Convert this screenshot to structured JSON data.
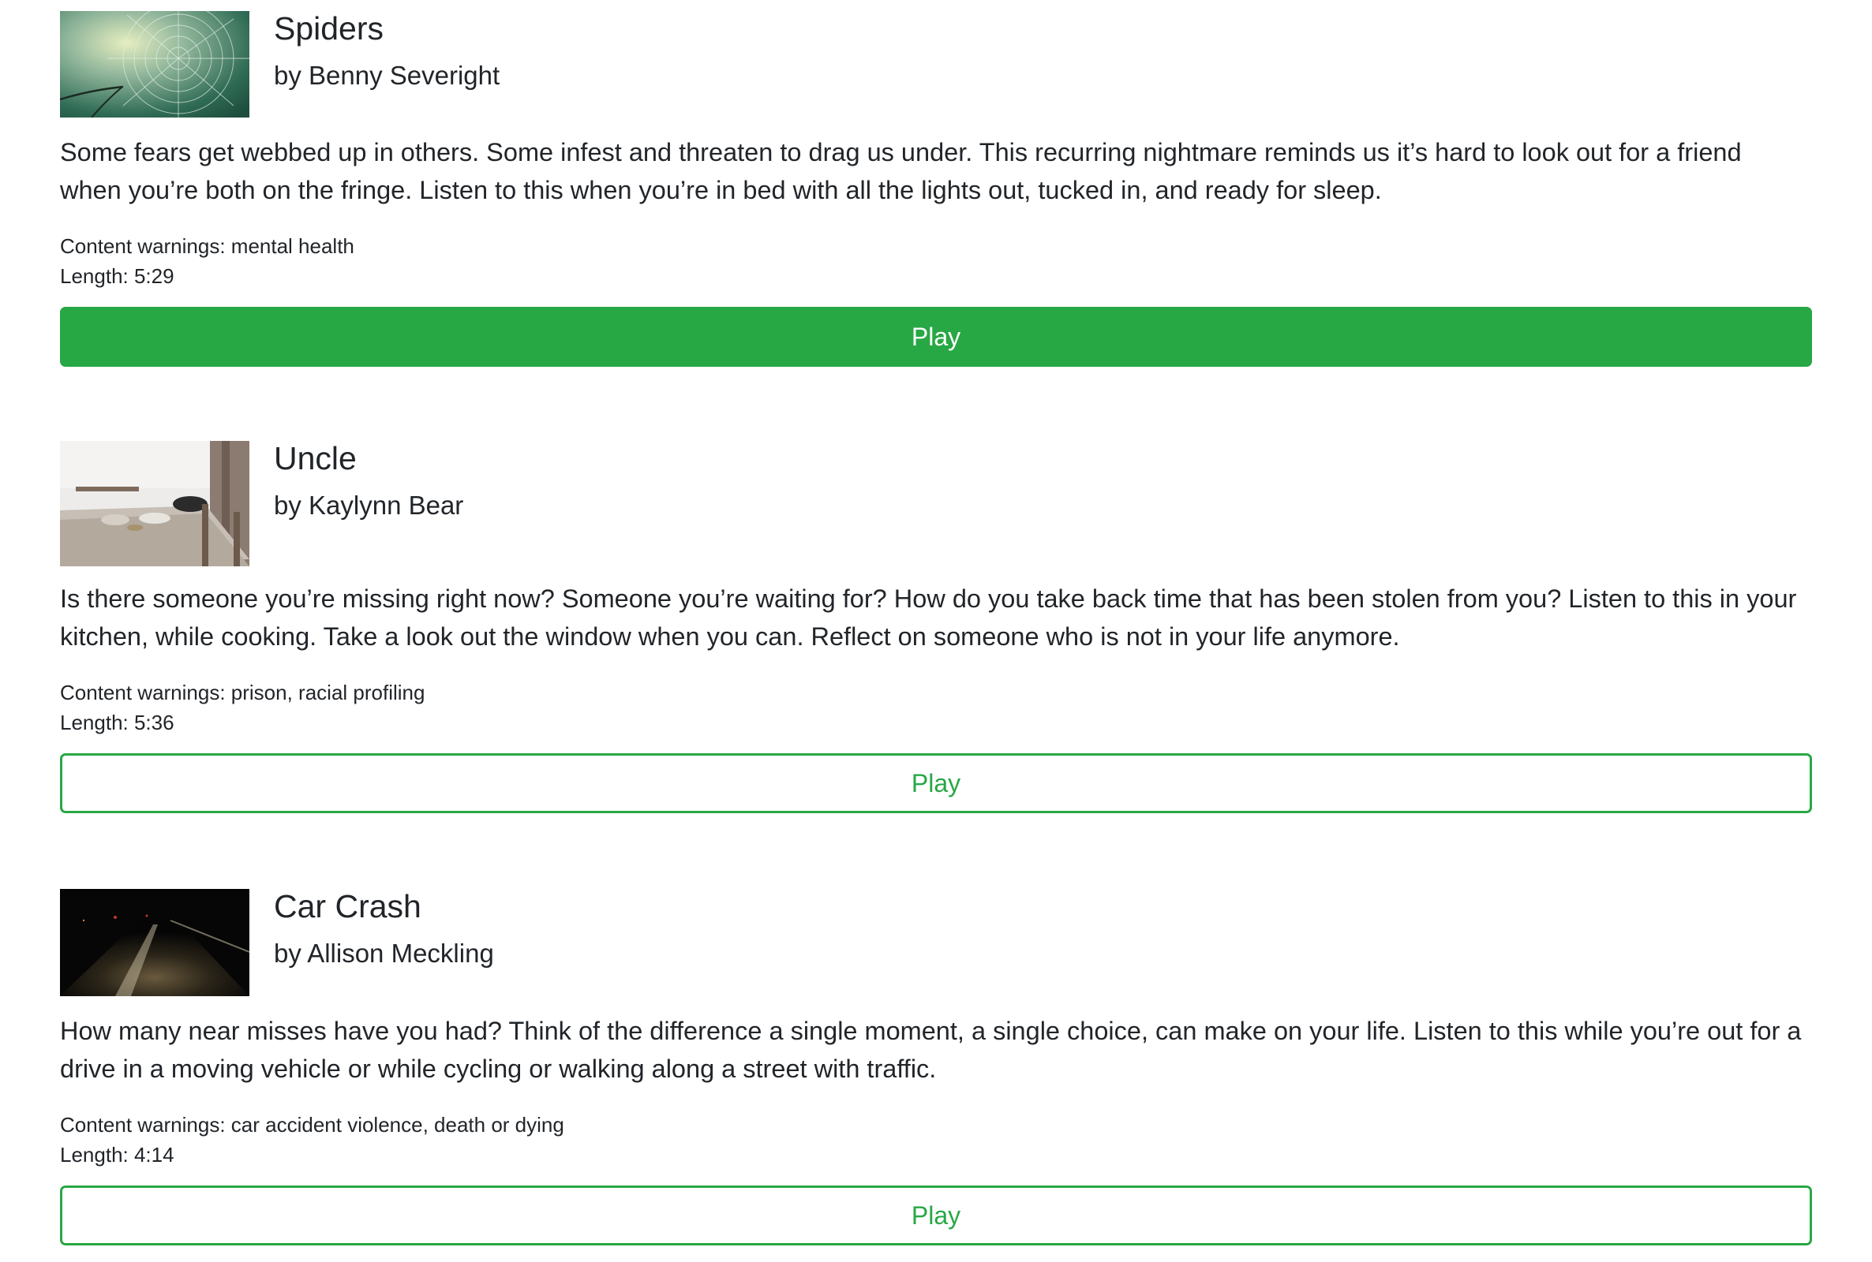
{
  "stories": [
    {
      "title": "Spiders",
      "author": "by Benny Severight",
      "description": "Some fears get webbed up in others. Some infest and threaten to drag us under. This recurring nightmare reminds us it’s hard to look out for a friend when you’re both on the fringe. Listen to this when you’re in bed with all the lights out, tucked in, and ready for sleep.",
      "warnings": "Content warnings: mental health",
      "length": "Length: 5:29",
      "play_label": "Play",
      "thumbnail_icon": "spider-web-image"
    },
    {
      "title": "Uncle",
      "author": "by Kaylynn Bear",
      "description": "Is there someone you’re missing right now? Someone you’re waiting for? How do you take back time that has been stolen from you? Listen to this in your kitchen, while cooking. Take a look out the window when you can. Reflect on someone who is not in your life anymore.",
      "warnings": "Content warnings: prison, racial profiling",
      "length": "Length: 5:36",
      "play_label": "Play",
      "thumbnail_icon": "kitchen-table-image"
    },
    {
      "title": "Car Crash",
      "author": "by Allison Meckling",
      "description": "How many near misses have you had? Think of the difference a single moment, a single choice, can make on your life. Listen to this while you’re out for a drive in a moving vehicle or while cycling or walking along a street with traffic.",
      "warnings": "Content warnings: car accident violence, death or dying",
      "length": "Length: 4:14",
      "play_label": "Play",
      "thumbnail_icon": "night-road-image"
    }
  ],
  "colors": {
    "accent": "#28a745",
    "text": "#212529",
    "background": "#ffffff"
  }
}
